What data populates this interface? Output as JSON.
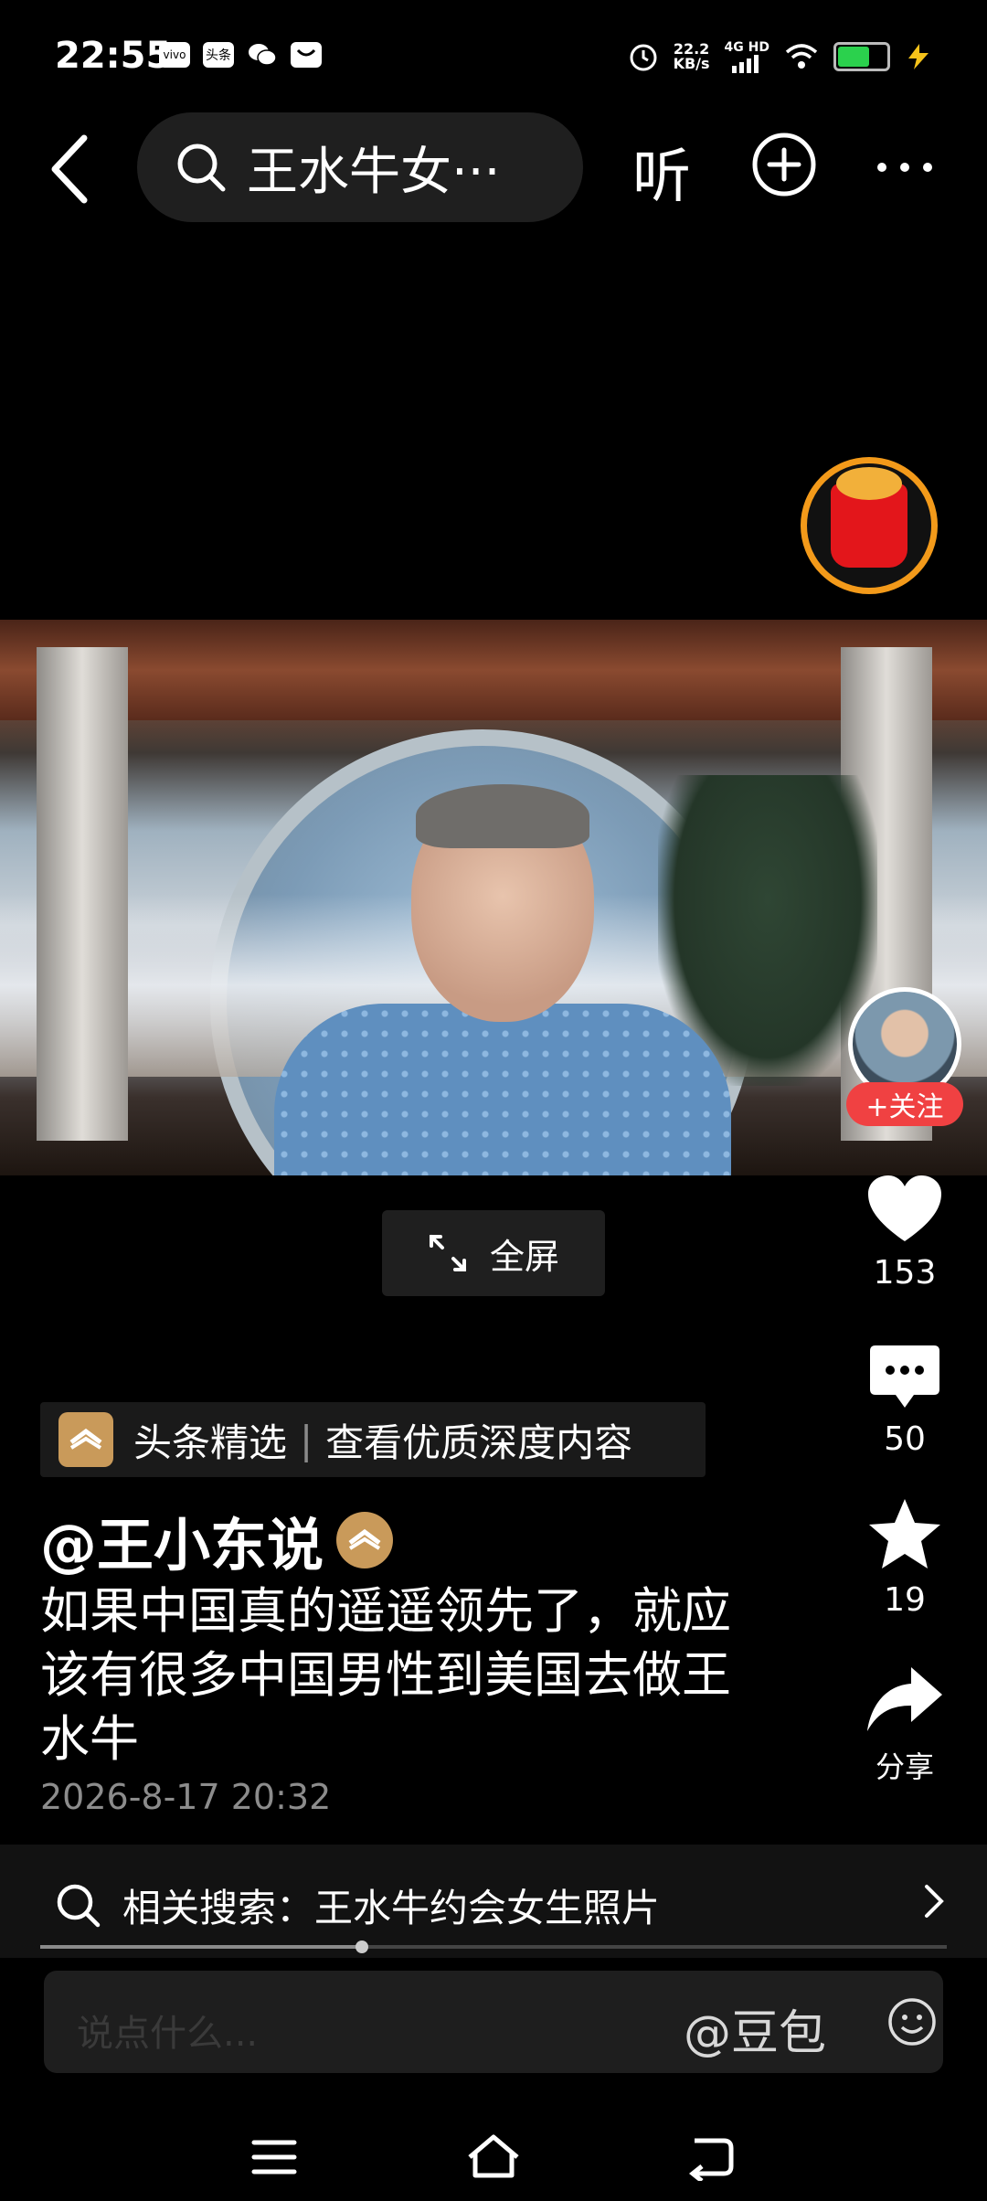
{
  "status_bar": {
    "time": "22:55",
    "app_icons": [
      "vivo",
      "头条",
      "wechat",
      "message"
    ],
    "net_speed_value": "22.2",
    "net_speed_unit": "KB/s",
    "network": "4G HD"
  },
  "top_nav": {
    "search_text": "王水牛女···",
    "listen_label": "听"
  },
  "video": {
    "fullscreen_label": "全屏"
  },
  "author_panel": {
    "follow_label": "+关注"
  },
  "actions": {
    "likes": "153",
    "comments": "50",
    "favorites": "19",
    "share_label": "分享"
  },
  "source_tag": {
    "name": "头条精选",
    "tagline": "查看优质深度内容"
  },
  "post": {
    "author": "@王小东说",
    "description": "如果中国真的遥遥领先了，就应该有很多中国男性到美国去做王水牛",
    "timestamp": "2026-8-17 20:32"
  },
  "related_search": {
    "label": "相关搜索：王水牛约会女生照片"
  },
  "progress": {
    "fraction": 0.355
  },
  "comment_bar": {
    "placeholder": "说点什么...",
    "mention": "@豆包"
  },
  "colors": {
    "accent_follow": "#f04142",
    "badge_gold": "#c99a5a",
    "redpacket_ring": "#f39a1a"
  }
}
